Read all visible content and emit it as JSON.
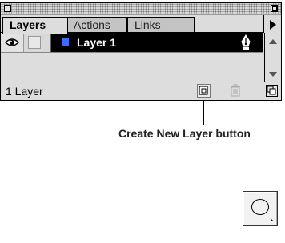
{
  "palette": {
    "tabs": [
      {
        "label": "Layers",
        "active": true
      },
      {
        "label": "Actions",
        "active": false
      },
      {
        "label": "Links",
        "active": false
      }
    ],
    "layers": [
      {
        "name": "Layer 1",
        "visible": true,
        "locked": false,
        "selected": true,
        "color": "#3b6cff"
      }
    ],
    "status_text": "1 Layer"
  },
  "callout": {
    "label": "Create New Layer button"
  },
  "tool": {
    "icon": "ellipse-tool-icon"
  },
  "colors": {
    "selection": "#000000",
    "layer_color": "#3b6cff"
  }
}
